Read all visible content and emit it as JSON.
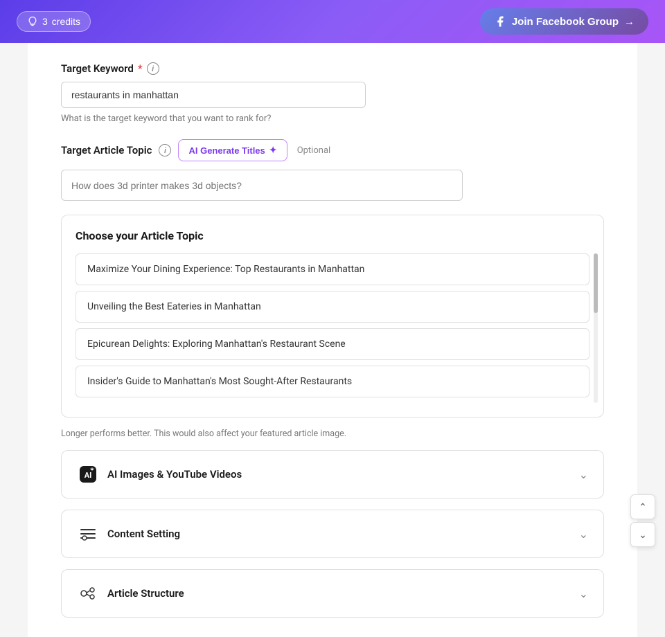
{
  "header": {
    "credits_count": "3",
    "credits_label": "credits",
    "join_facebook_label": "Join Facebook Group",
    "join_arrow": "→"
  },
  "form": {
    "target_keyword": {
      "label": "Target Keyword",
      "required": true,
      "info_tooltip": "i",
      "value": "restaurants in manhattan",
      "helper_text": "What is the target keyword that you want to rank for?"
    },
    "target_article_topic": {
      "label": "Target Article Topic",
      "info_tooltip": "i",
      "ai_generate_label": "AI Generate Titles",
      "optional_label": "Optional",
      "placeholder": "How does 3d printer makes 3d objects?"
    },
    "choose_topic": {
      "title": "Choose your Article Topic",
      "items": [
        "Maximize Your Dining Experience: Top Restaurants in Manhattan",
        "Unveiling the Best Eateries in Manhattan",
        "Epicurean Delights: Exploring Manhattan's Restaurant Scene",
        "Insider's Guide to Manhattan's Most Sought-After Restaurants"
      ]
    },
    "longer_performs_text": "Longer performs better. This would also affect your featured article image.",
    "sections": [
      {
        "id": "ai-images",
        "icon": "ai-icon",
        "label": "AI Images & YouTube Videos"
      },
      {
        "id": "content-setting",
        "icon": "content-setting-icon",
        "label": "Content Setting"
      },
      {
        "id": "article-structure",
        "icon": "article-structure-icon",
        "label": "Article Structure"
      }
    ]
  }
}
